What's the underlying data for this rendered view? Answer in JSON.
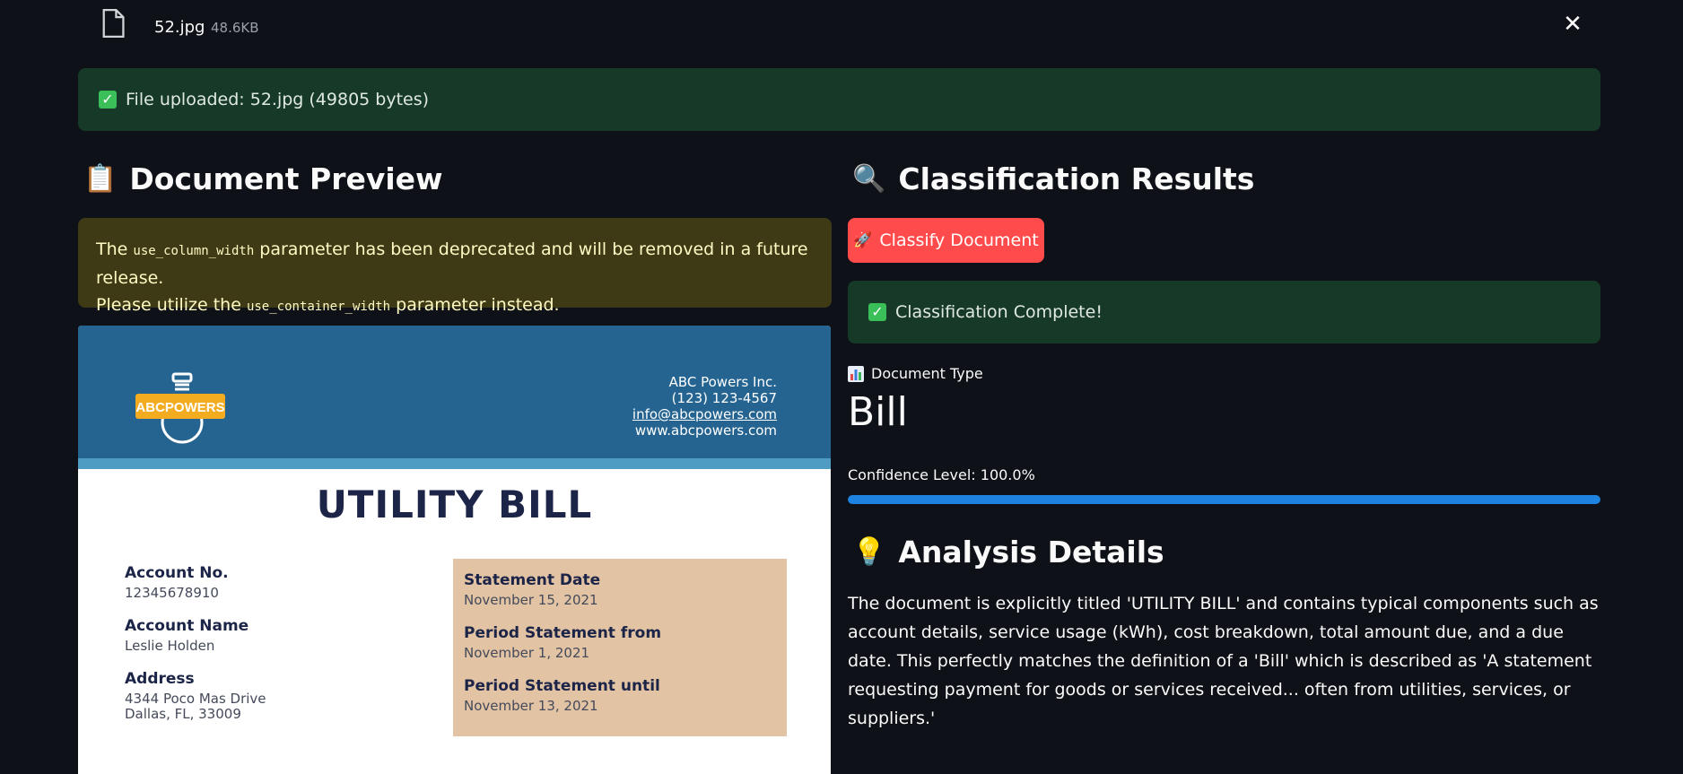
{
  "file": {
    "name": "52.jpg",
    "size": "48.6KB",
    "close_icon": "close-icon"
  },
  "upload_alert": {
    "text": "File uploaded: 52.jpg (49805 bytes)",
    "check": "✓"
  },
  "preview": {
    "title": "Document Preview",
    "icon": "clipboard-icon",
    "warning": {
      "part1": "The ",
      "code1": "use_column_width",
      "part2": " parameter has been deprecated and will be removed in a future release.",
      "part3": "Please utilize the ",
      "code2": "use_container_width",
      "part4": " parameter instead."
    },
    "document": {
      "logo_text": "ABCPOWERS",
      "company": "ABC Powers Inc.",
      "phone": "(123) 123-4567",
      "email": "info@abcpowers.com",
      "website": "www.abcpowers.com",
      "title": "UTILITY BILL",
      "fields": [
        {
          "label": "Account No.",
          "value": "12345678910"
        },
        {
          "label": "Account Name",
          "value": "Leslie Holden"
        },
        {
          "label": "Address",
          "value_line1": "4344 Poco Mas Drive",
          "value_line2": "Dallas, FL, 33009"
        }
      ],
      "box_fields": [
        {
          "label": "Statement Date",
          "value": "November 15, 2021"
        },
        {
          "label": "Period Statement from",
          "value": "November 1, 2021"
        },
        {
          "label": "Period Statement until",
          "value": "November 13, 2021"
        }
      ]
    }
  },
  "results": {
    "title": "Classification Results",
    "icon": "magnifier-icon",
    "classify_button": "Classify Document",
    "complete_alert": "Classification Complete!",
    "document_type_label": "Document Type",
    "document_type": "Bill",
    "confidence_label": "Confidence Level: 100.0%",
    "confidence": 1.0
  },
  "analysis": {
    "title": "Analysis Details",
    "icon": "lightbulb-icon",
    "text": "The document is explicitly titled 'UTILITY BILL' and contains typical components such as account details, service usage (kWh), cost breakdown, total amount due, and a due date. This perfectly matches the definition of a 'Bill' which is described as 'A statement requesting payment for goods or services received... often from utilities, services, or suppliers.'"
  },
  "colors": {
    "background": "#0e1117",
    "success_bg": "#173928",
    "warning_bg": "#3e3a16",
    "primary_button": "#ff4b4b",
    "progress": "#1c83e1",
    "doc_header": "#256491",
    "doc_box": "#e2c3a4"
  }
}
